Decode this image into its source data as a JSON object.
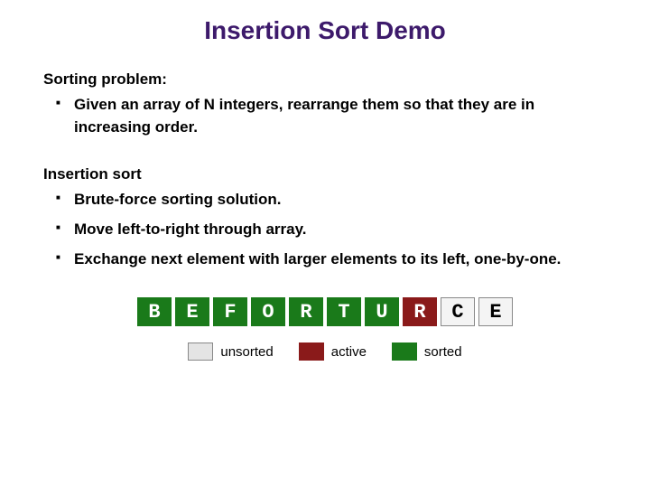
{
  "title": "Insertion Sort Demo",
  "section1": {
    "heading": "Sorting problem:",
    "bullets": [
      "Given an array of N integers, rearrange them so that they are in increasing order."
    ]
  },
  "section2": {
    "heading": "Insertion sort",
    "bullets": [
      "Brute-force sorting solution.",
      "Move left-to-right through array.",
      "Exchange next element with larger elements to its left, one-by-one."
    ]
  },
  "array": [
    {
      "letter": "B",
      "state": "sorted"
    },
    {
      "letter": "E",
      "state": "sorted"
    },
    {
      "letter": "F",
      "state": "sorted"
    },
    {
      "letter": "O",
      "state": "sorted"
    },
    {
      "letter": "R",
      "state": "sorted"
    },
    {
      "letter": "T",
      "state": "sorted"
    },
    {
      "letter": "U",
      "state": "sorted"
    },
    {
      "letter": "R",
      "state": "active"
    },
    {
      "letter": "C",
      "state": "unsorted"
    },
    {
      "letter": "E",
      "state": "unsorted"
    }
  ],
  "legend": {
    "unsorted": "unsorted",
    "active": "active",
    "sorted": "sorted"
  }
}
